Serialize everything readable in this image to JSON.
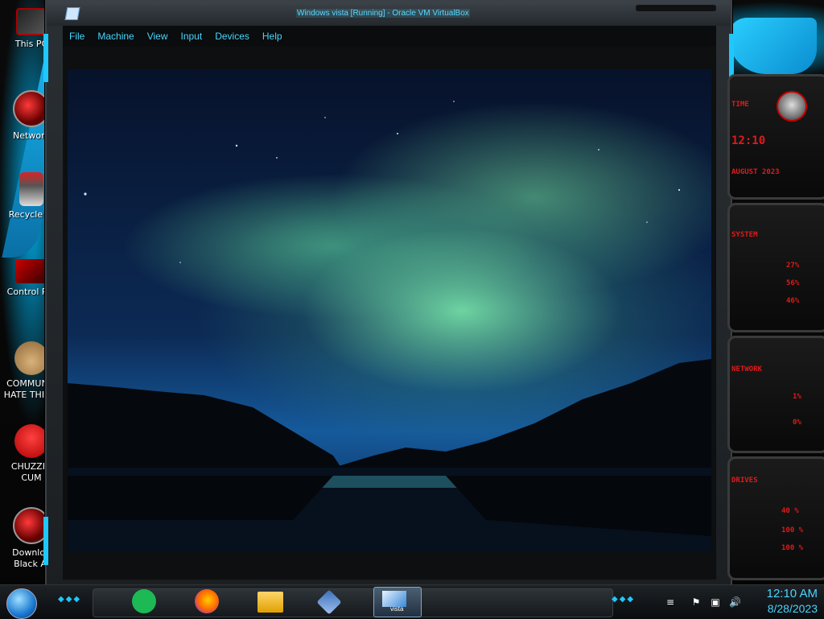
{
  "window": {
    "title": "Windows vista [Running] - Oracle VM VirtualBox"
  },
  "menu": {
    "items": [
      {
        "label": "File"
      },
      {
        "label": "Machine"
      },
      {
        "label": "View"
      },
      {
        "label": "Input"
      },
      {
        "label": "Devices"
      },
      {
        "label": "Help"
      }
    ]
  },
  "desktop": {
    "icons": [
      {
        "label": "This PC",
        "icon": "computer-icon"
      },
      {
        "label": "Network",
        "icon": "network-icon"
      },
      {
        "label": "Recycle Bi",
        "icon": "recycle-bin-icon"
      },
      {
        "label": "Control Par",
        "icon": "control-panel-icon"
      },
      {
        "label": "COMMUNIS HATE THIS C",
        "icon": "money-bag-icon"
      },
      {
        "label": "CHUZZIN CUM",
        "icon": "chuzzle-icon"
      },
      {
        "label": "Downloa Black Al",
        "icon": "download-icon"
      }
    ]
  },
  "gadgets": {
    "time_label": "TIME",
    "time_value": "12:10",
    "date_value": "AUGUST 2023",
    "system_label": "SYSTEM",
    "system_values": [
      "27%",
      "56%",
      "46%"
    ],
    "network_label": "NETWORK",
    "network_values": [
      "1%",
      "0%"
    ],
    "drives_label": "DRIVES",
    "drives_values": [
      "40 %",
      "100 %",
      "100 %"
    ]
  },
  "taskbar": {
    "apps": [
      {
        "name": "Spotify",
        "icon": "spotify-icon"
      },
      {
        "name": "Firefox",
        "icon": "firefox-icon"
      },
      {
        "name": "File Explorer",
        "icon": "folder-icon"
      },
      {
        "name": "VirtualBox",
        "icon": "virtualbox-icon"
      },
      {
        "name": "vista",
        "icon": "vista-icon",
        "active": true
      }
    ],
    "clock": {
      "time": "12:10 AM",
      "date": "8/28/2023"
    }
  },
  "colors": {
    "accent": "#1ec8ff",
    "gadget_red": "#e01a1a",
    "menu_text": "#45d6ff"
  }
}
